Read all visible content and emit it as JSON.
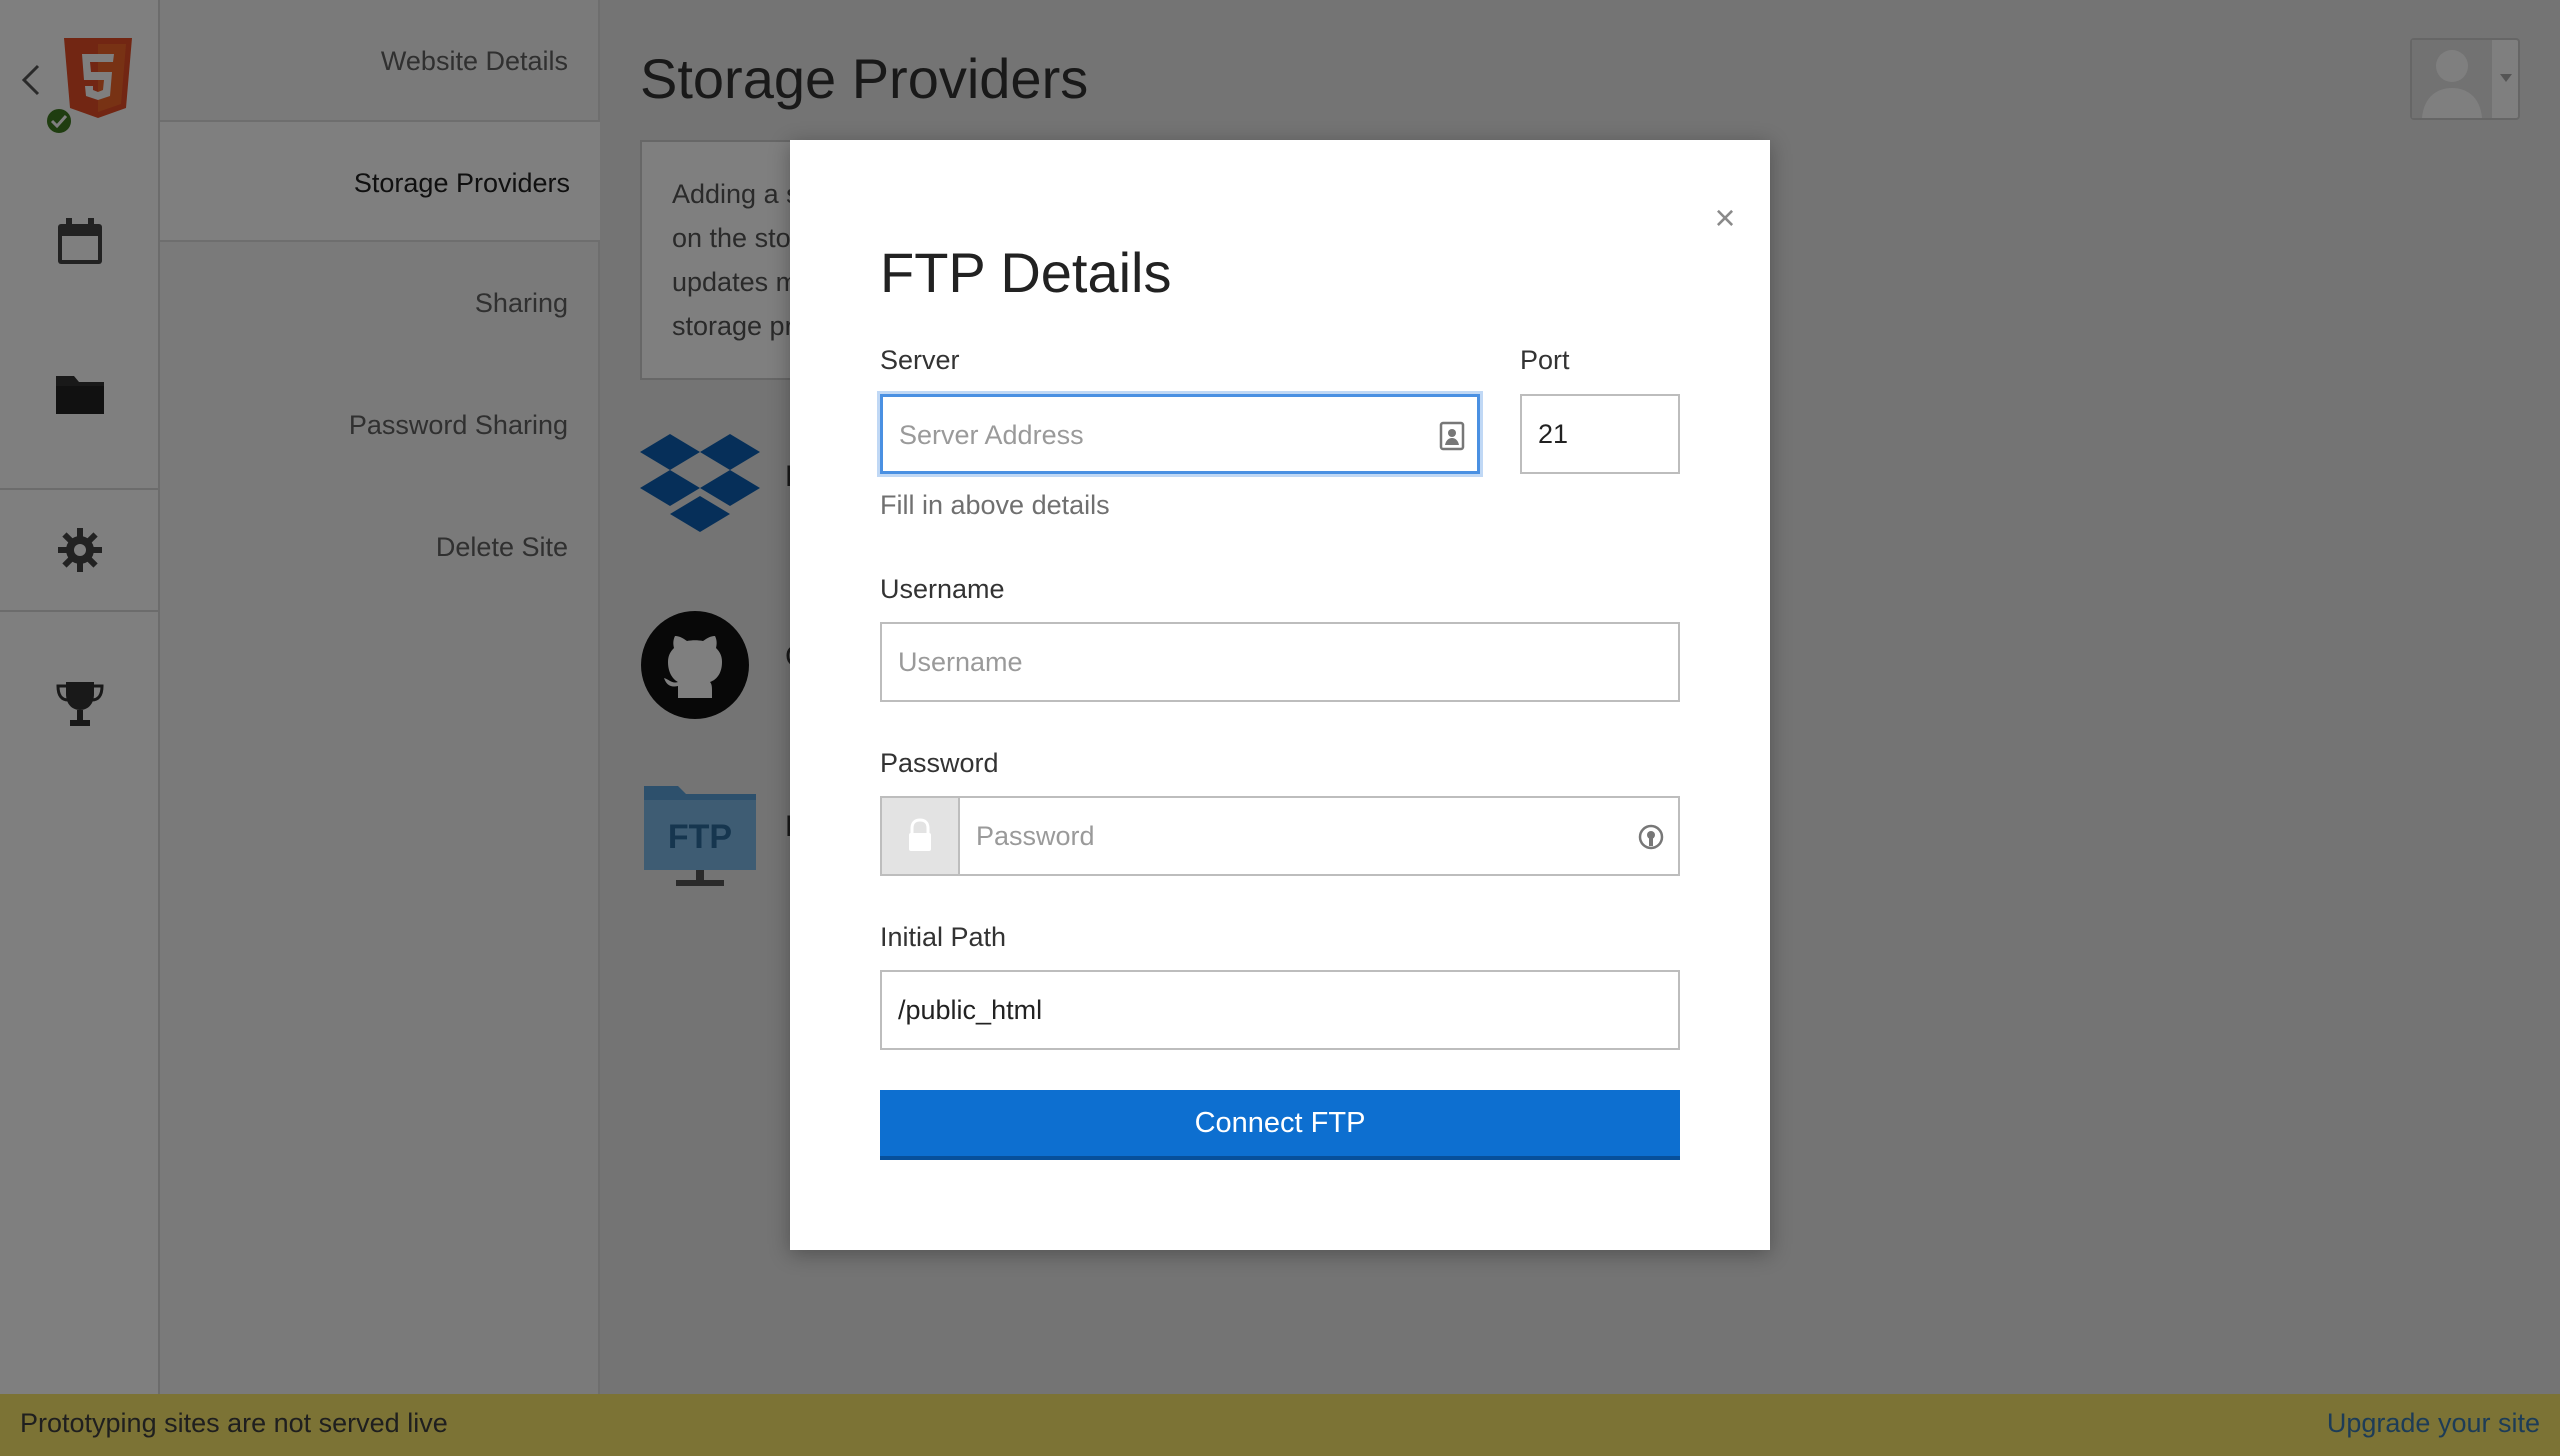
{
  "sidebar": {
    "items": [
      {
        "label": "Website Details"
      },
      {
        "label": "Storage Providers"
      },
      {
        "label": "Sharing"
      },
      {
        "label": "Password Sharing"
      },
      {
        "label": "Delete Site"
      }
    ]
  },
  "main": {
    "title": "Storage Providers",
    "info_lines": [
      "Adding a s",
      "on the stor",
      "updates m",
      "storage pr"
    ],
    "providers": [
      {
        "icon": "dropbox-icon",
        "label": "D"
      },
      {
        "icon": "github-icon",
        "label": "G"
      },
      {
        "icon": "ftp-icon",
        "label": "F",
        "icon_text": "FTP"
      }
    ]
  },
  "modal": {
    "title": "FTP Details",
    "close_label": "×",
    "server": {
      "label": "Server",
      "placeholder": "Server Address",
      "value": ""
    },
    "port": {
      "label": "Port",
      "value": "21"
    },
    "hint": "Fill in above details",
    "username": {
      "label": "Username",
      "placeholder": "Username",
      "value": ""
    },
    "password": {
      "label": "Password",
      "placeholder": "Password",
      "value": ""
    },
    "initial_path": {
      "label": "Initial Path",
      "value": "/public_html"
    },
    "submit_label": "Connect FTP"
  },
  "banner": {
    "message": "Prototyping sites are not served live",
    "upgrade_link": "Upgrade your site"
  },
  "colors": {
    "accent": "#0d6fd0",
    "banner": "#7c7335",
    "html5": "#e44d26",
    "dropbox": "#0d5fb3"
  }
}
